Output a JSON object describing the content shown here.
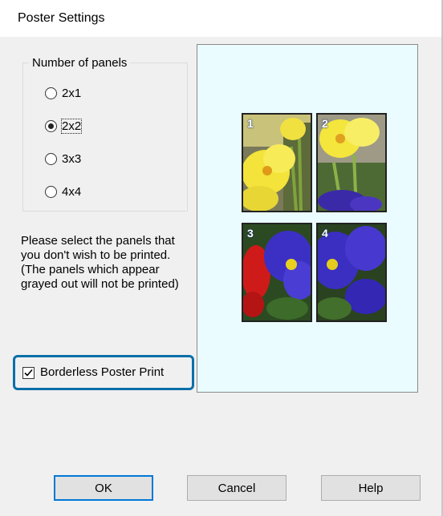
{
  "dialog": {
    "title": "Poster Settings"
  },
  "panels_group": {
    "label": "Number of panels",
    "options": [
      {
        "label": "2x1",
        "selected": false
      },
      {
        "label": "2x2",
        "selected": true
      },
      {
        "label": "3x3",
        "selected": false
      },
      {
        "label": "4x4",
        "selected": false
      }
    ]
  },
  "instructions": "Please select the panels that you don't wish to be printed. (The panels which appear grayed out will not be printed)",
  "borderless": {
    "label": "Borderless Poster Print",
    "checked": true
  },
  "preview": {
    "panels": [
      {
        "number": "1"
      },
      {
        "number": "2"
      },
      {
        "number": "3"
      },
      {
        "number": "4"
      }
    ]
  },
  "buttons": {
    "ok": "OK",
    "cancel": "Cancel",
    "help": "Help"
  },
  "colors": {
    "highlight_border": "#0b6fa8",
    "preview_bg": "#eafcff",
    "default_button_border": "#0078d7"
  }
}
